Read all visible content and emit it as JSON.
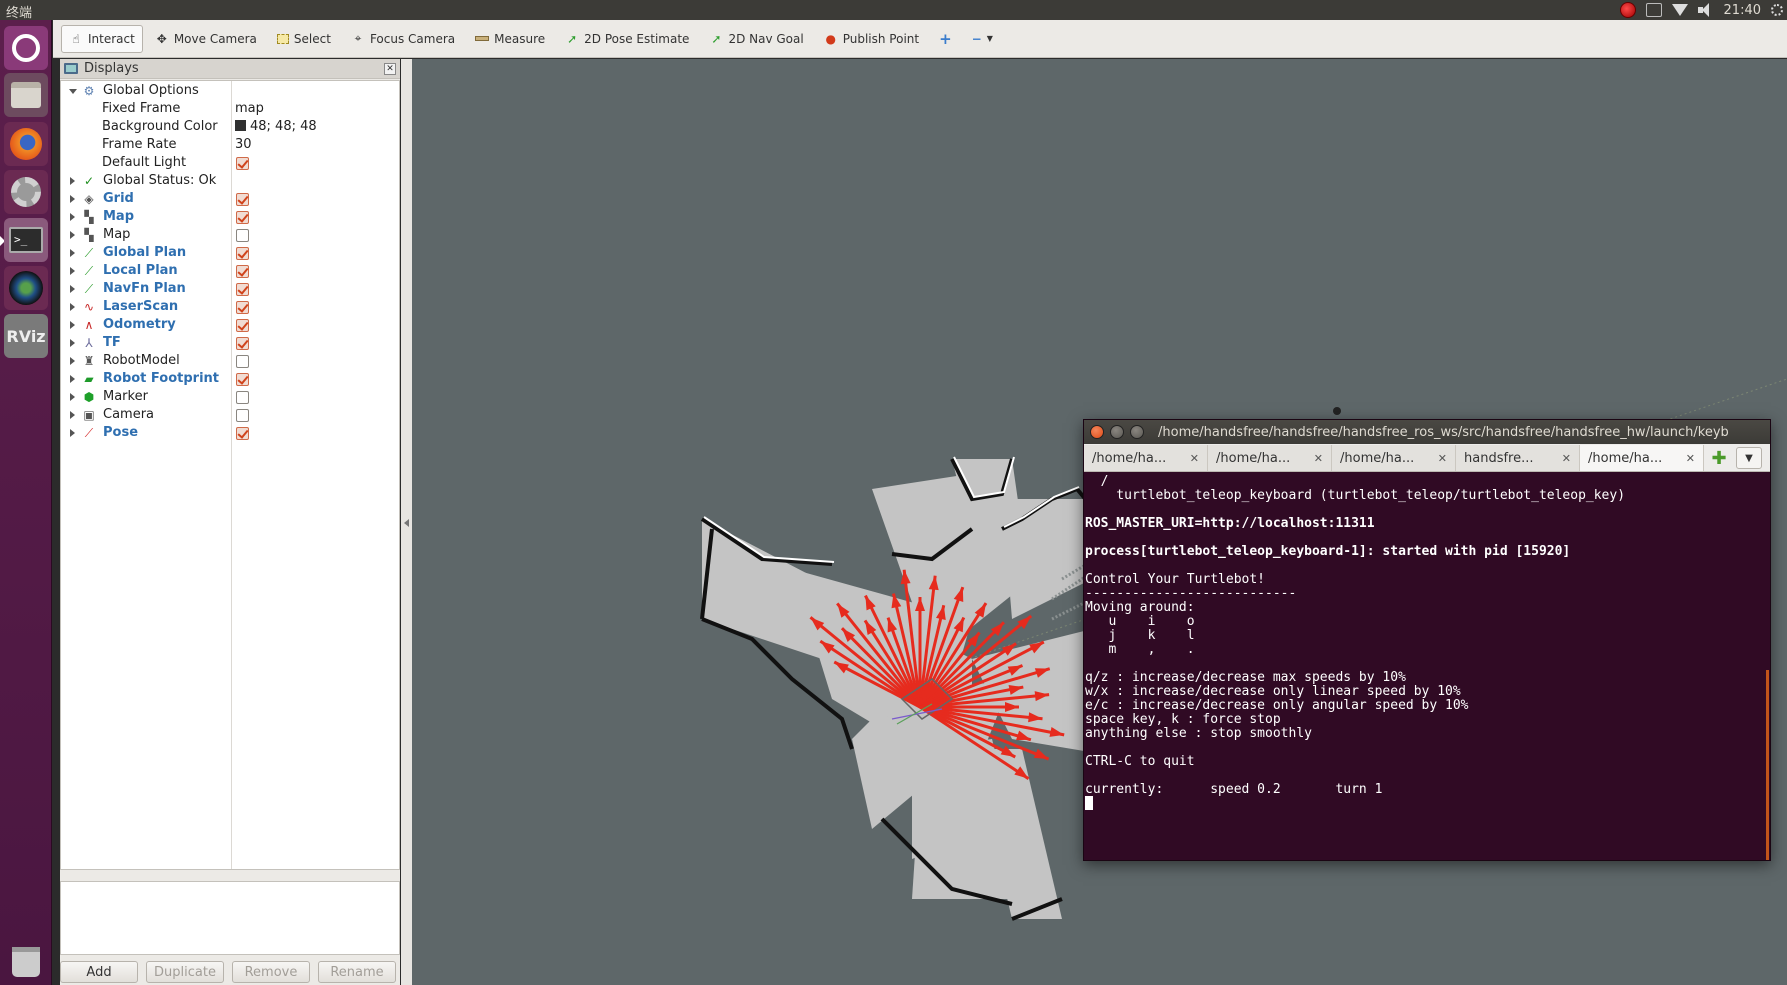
{
  "system_bar": {
    "title": "终端",
    "clock": "21:40"
  },
  "launcher": {
    "items": [
      "ubuntu-dash",
      "files",
      "firefox",
      "system-settings",
      "terminal",
      "camera",
      "rviz",
      "trash"
    ],
    "rviz_label": "RViz"
  },
  "toolbar": {
    "tools": [
      {
        "label": "Interact",
        "icon": "hand-icon",
        "active": true
      },
      {
        "label": "Move Camera",
        "icon": "move-camera-icon"
      },
      {
        "label": "Select",
        "icon": "select-icon"
      },
      {
        "label": "Focus Camera",
        "icon": "focus-icon"
      },
      {
        "label": "Measure",
        "icon": "ruler-icon"
      },
      {
        "label": "2D Pose Estimate",
        "icon": "green-arrow-icon"
      },
      {
        "label": "2D Nav Goal",
        "icon": "green-arrow-icon"
      },
      {
        "label": "Publish Point",
        "icon": "pin-icon"
      }
    ]
  },
  "displays_panel": {
    "title": "Displays",
    "rows": [
      {
        "label": "Global Options",
        "level": 0,
        "expanded": true,
        "icon": "gear-icon"
      },
      {
        "label": "Fixed Frame",
        "level": 1,
        "value": "map"
      },
      {
        "label": "Background Color",
        "level": 1,
        "value": "48; 48; 48",
        "swatch": "#303030"
      },
      {
        "label": "Frame Rate",
        "level": 1,
        "value": "30"
      },
      {
        "label": "Default Light",
        "level": 1,
        "checked": true
      },
      {
        "label": "Global Status: Ok",
        "level": 0,
        "icon": "check-icon"
      },
      {
        "label": "Grid",
        "level": 0,
        "blue": true,
        "checked": true,
        "icon": "grid-icon"
      },
      {
        "label": "Map",
        "level": 0,
        "blue": true,
        "checked": true,
        "icon": "map-icon"
      },
      {
        "label": "Map",
        "level": 0,
        "checked": false,
        "icon": "map-icon"
      },
      {
        "label": "Global Plan",
        "level": 0,
        "blue": true,
        "checked": true,
        "icon": "path-icon"
      },
      {
        "label": "Local Plan",
        "level": 0,
        "blue": true,
        "checked": true,
        "icon": "path-icon"
      },
      {
        "label": "NavFn Plan",
        "level": 0,
        "blue": true,
        "checked": true,
        "icon": "path-icon"
      },
      {
        "label": "LaserScan",
        "level": 0,
        "blue": true,
        "checked": true,
        "icon": "laser-icon"
      },
      {
        "label": "Odometry",
        "level": 0,
        "blue": true,
        "checked": true,
        "icon": "odometry-icon"
      },
      {
        "label": "TF",
        "level": 0,
        "blue": true,
        "checked": true,
        "icon": "tf-icon"
      },
      {
        "label": "RobotModel",
        "level": 0,
        "checked": false,
        "icon": "robot-icon"
      },
      {
        "label": "Robot Footprint",
        "level": 0,
        "blue": true,
        "checked": true,
        "icon": "footprint-icon"
      },
      {
        "label": "Marker",
        "level": 0,
        "checked": false,
        "icon": "marker-icon"
      },
      {
        "label": "Camera",
        "level": 0,
        "checked": false,
        "icon": "camera-icon"
      },
      {
        "label": "Pose",
        "level": 0,
        "blue": true,
        "checked": true,
        "icon": "pose-icon"
      }
    ],
    "buttons": {
      "add": "Add",
      "duplicate": "Duplicate",
      "remove": "Remove",
      "rename": "Rename"
    }
  },
  "terminal": {
    "title": "/home/handsfree/handsfree/handsfree_ros_ws/src/handsfree/handsfree_hw/launch/keyb",
    "tabs": [
      "/home/ha...",
      "/home/ha...",
      "/home/ha...",
      "handsfre...",
      "/home/ha..."
    ],
    "lines": [
      {
        "text": "  /",
        "bold": false
      },
      {
        "text": "    turtlebot_teleop_keyboard (turtlebot_teleop/turtlebot_teleop_key)",
        "bold": false
      },
      {
        "text": "",
        "bold": false
      },
      {
        "text": "ROS_MASTER_URI=http://localhost:11311",
        "bold": true
      },
      {
        "text": "",
        "bold": false
      },
      {
        "text": "process[turtlebot_teleop_keyboard-1]: started with pid [15920]",
        "bold": true
      },
      {
        "text": "",
        "bold": false
      },
      {
        "text": "Control Your Turtlebot!",
        "bold": false
      },
      {
        "text": "---------------------------",
        "bold": false
      },
      {
        "text": "Moving around:",
        "bold": false
      },
      {
        "text": "   u    i    o",
        "bold": false
      },
      {
        "text": "   j    k    l",
        "bold": false
      },
      {
        "text": "   m    ,    .",
        "bold": false
      },
      {
        "text": "",
        "bold": false
      },
      {
        "text": "q/z : increase/decrease max speeds by 10%",
        "bold": false
      },
      {
        "text": "w/x : increase/decrease only linear speed by 10%",
        "bold": false
      },
      {
        "text": "e/c : increase/decrease only angular speed by 10%",
        "bold": false
      },
      {
        "text": "space key, k : force stop",
        "bold": false
      },
      {
        "text": "anything else : stop smoothly",
        "bold": false
      },
      {
        "text": "",
        "bold": false
      },
      {
        "text": "CTRL-C to quit",
        "bold": false
      },
      {
        "text": "",
        "bold": false
      },
      {
        "text": "currently:      speed 0.2       turn 1",
        "bold": false
      }
    ]
  },
  "colors": {
    "view_background": "#5e6769",
    "laser": "#e62b1e",
    "terminal_bg": "#300a24",
    "launcher_bg": "#5c1f4c"
  }
}
